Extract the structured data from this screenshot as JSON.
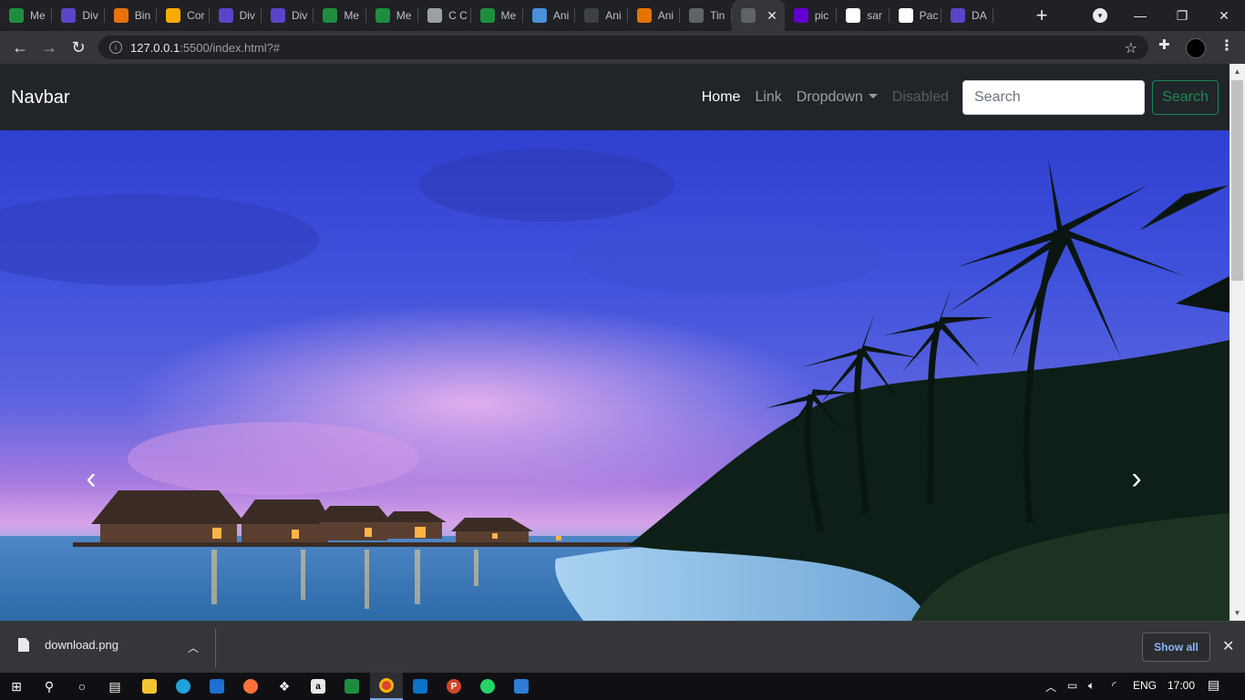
{
  "browser": {
    "tabs": [
      {
        "title": "Me",
        "icon": "meet-icon",
        "color": "#1e8e3e"
      },
      {
        "title": "Div",
        "icon": "list-icon",
        "color": "#5c43c9"
      },
      {
        "title": "Bin",
        "icon": "r-icon",
        "color": "#e8710a"
      },
      {
        "title": "Cor",
        "icon": "circle-icon",
        "color": "#f9ab00"
      },
      {
        "title": "Div",
        "icon": "list-icon",
        "color": "#5c43c9"
      },
      {
        "title": "Div",
        "icon": "list-icon",
        "color": "#5c43c9"
      },
      {
        "title": "Me",
        "icon": "meet-icon",
        "color": "#1e8e3e"
      },
      {
        "title": "Me",
        "icon": "meet-icon",
        "color": "#1e8e3e"
      },
      {
        "title": "C C",
        "icon": "at-icon",
        "color": "#9aa0a6"
      },
      {
        "title": "Me",
        "icon": "meet-icon",
        "color": "#1e8e3e"
      },
      {
        "title": "Ani",
        "icon": "ani-icon",
        "color": "#4a90d9"
      },
      {
        "title": "Ani",
        "icon": "g-icon",
        "color": "#3c4043"
      },
      {
        "title": "Ani",
        "icon": "ani-icon",
        "color": "#e37400"
      },
      {
        "title": "Tin",
        "icon": "globe-icon",
        "color": "#5f6368"
      },
      {
        "title": "",
        "icon": "globe-icon",
        "color": "#5f6368",
        "active": true
      },
      {
        "title": "pic",
        "icon": "yahoo-icon",
        "color": "#6001d2"
      },
      {
        "title": "sar",
        "icon": "google-icon",
        "color": "#ffffff"
      },
      {
        "title": "Pac",
        "icon": "github-icon",
        "color": "#ffffff"
      },
      {
        "title": "DA",
        "icon": "list-icon",
        "color": "#5c43c9"
      }
    ],
    "url_host": "127.0.0.1",
    "url_path": ":5500/index.html?#"
  },
  "page": {
    "brand": "Navbar",
    "nav": {
      "home": "Home",
      "link": "Link",
      "dropdown": "Dropdown",
      "disabled": "Disabled"
    },
    "search_placeholder": "Search",
    "search_button": "Search",
    "carousel": {
      "prev_symbol": "‹",
      "next_symbol": "›"
    }
  },
  "downloads": {
    "filename": "download.png",
    "show_all": "Show all"
  },
  "taskbar": {
    "language": "ENG",
    "time": "17:00"
  }
}
